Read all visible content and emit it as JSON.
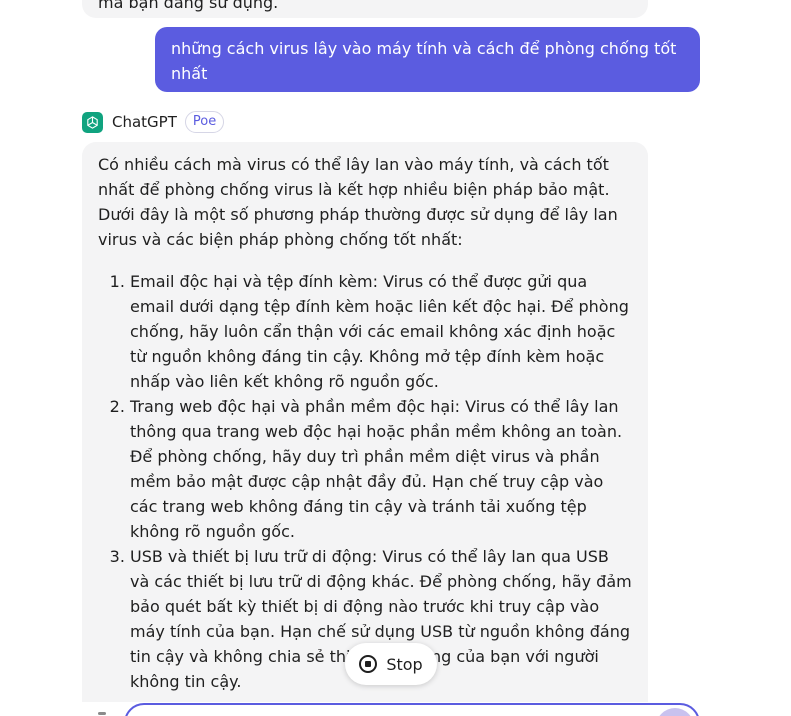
{
  "previous_message": {
    "text": "mà bạn đang sử dụng."
  },
  "user_message": {
    "text": "những cách virus lây vào máy tính và cách để phòng chống tốt nhất"
  },
  "bot": {
    "name": "ChatGPT",
    "badge": "Poe",
    "avatar_icon": "openai-logo-icon",
    "avatar_color": "#10a37f"
  },
  "bot_message": {
    "intro": "Có nhiều cách mà virus có thể lây lan vào máy tính, và cách tốt nhất để phòng chống virus là kết hợp nhiều biện pháp bảo mật. Dưới đây là một số phương pháp thường được sử dụng để lây lan virus và các biện pháp phòng chống tốt nhất:",
    "items": [
      "Email độc hại và tệp đính kèm: Virus có thể được gửi qua email dưới dạng tệp đính kèm hoặc liên kết độc hại. Để phòng chống, hãy luôn cẩn thận với các email không xác định hoặc từ nguồn không đáng tin cậy. Không mở tệp đính kèm hoặc nhấp vào liên kết không rõ nguồn gốc.",
      "Trang web độc hại và phần mềm độc hại: Virus có thể lây lan thông qua trang web độc hại hoặc phần mềm không an toàn. Để phòng chống, hãy duy trì phần mềm diệt virus và phần mềm bảo mật được cập nhật đầy đủ. Hạn chế truy cập vào các trang web không đáng tin cậy và tránh tải xuống tệp không rõ nguồn gốc.",
      "USB và thiết bị lưu trữ di động: Virus có thể lây lan qua USB và các thiết bị lưu trữ di động khác. Để phòng chống, hãy đảm bảo quét bất kỳ thiết bị di động nào trước khi truy cập vào máy tính của bạn. Hạn chế sử dụng USB từ nguồn không đáng tin cậy và không chia sẻ thiết bị di động của bạn với người không tin cậy."
    ]
  },
  "stop_button": {
    "label": "Stop",
    "icon": "stop-circle-icon"
  },
  "colors": {
    "accent": "#5b5ce0",
    "bubble_bg": "#f4f4f5"
  }
}
